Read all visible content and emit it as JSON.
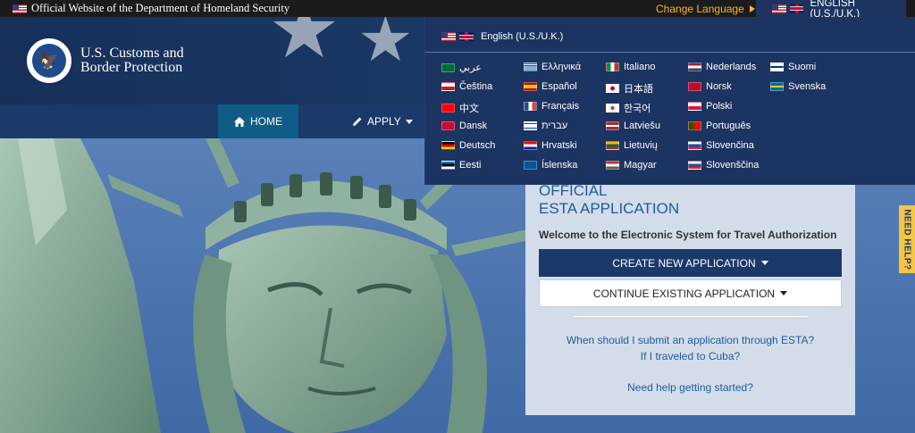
{
  "topbar": {
    "official_text": "Official Website of the Department of Homeland Security",
    "change_language": "Change Language",
    "current_language": "ENGLISH (U.S./U.K.)"
  },
  "header": {
    "title_line1": "U.S. Customs and",
    "title_line2": "Border Protection"
  },
  "nav": {
    "home": "HOME",
    "apply": "APPLY"
  },
  "language_menu": {
    "current": "English (U.S./U.K.)",
    "columns": [
      [
        {
          "label": "عربي",
          "flag": "arabic-flag"
        },
        {
          "label": "Čeština",
          "flag": "czech-flag"
        },
        {
          "label": "中文",
          "flag": "taiwan-flag"
        },
        {
          "label": "Dansk",
          "flag": "danish-flag"
        },
        {
          "label": "Deutsch",
          "flag": "german-flag"
        },
        {
          "label": "Eesti",
          "flag": "estonian-flag"
        }
      ],
      [
        {
          "label": "Ελληνικά",
          "flag": "greek-flag"
        },
        {
          "label": "Español",
          "flag": "spanish-flag"
        },
        {
          "label": "Français",
          "flag": "french-flag"
        },
        {
          "label": "עברית",
          "flag": "israeli-flag"
        },
        {
          "label": "Hrvatski",
          "flag": "croatian-flag"
        },
        {
          "label": "Íslenska",
          "flag": "icelandic-flag"
        }
      ],
      [
        {
          "label": "Italiano",
          "flag": "italian-flag"
        },
        {
          "label": "日本語",
          "flag": "japanese-flag"
        },
        {
          "label": "한국어",
          "flag": "korean-flag"
        },
        {
          "label": "Latviešu",
          "flag": "latvian-flag"
        },
        {
          "label": "Lietuvių",
          "flag": "lithuanian-flag"
        },
        {
          "label": "Magyar",
          "flag": "hungarian-flag"
        }
      ],
      [
        {
          "label": "Nederlands",
          "flag": "dutch-flag"
        },
        {
          "label": "Norsk",
          "flag": "norwegian-flag"
        },
        {
          "label": "Polski",
          "flag": "polish-flag"
        },
        {
          "label": "Português",
          "flag": "portuguese-flag"
        },
        {
          "label": "Slovenčina",
          "flag": "slovak-flag"
        },
        {
          "label": "Slovenščina",
          "flag": "slovenian-flag"
        }
      ],
      [
        {
          "label": "Suomi",
          "flag": "finnish-flag"
        },
        {
          "label": "Svenska",
          "flag": "swedish-flag"
        }
      ]
    ]
  },
  "esta_panel": {
    "heading_line1": "OFFICIAL",
    "heading_line2": "ESTA APPLICATION",
    "welcome": "Welcome to the Electronic System for Travel Authorization",
    "create_button": "CREATE NEW APPLICATION",
    "continue_button": "CONTINUE EXISTING APPLICATION",
    "link_when": "When should I submit an application through ESTA?",
    "link_cuba": "If I traveled to Cuba?",
    "link_help": "Need help getting started?"
  },
  "help_tab": {
    "label": "NEED HELP?"
  },
  "colors": {
    "topbar_bg": "#1b1b1b",
    "nav_bg": "#1b3a6a",
    "accent_gold": "#f5b72e",
    "link_blue": "#1f5c9b",
    "home_active": "#0f5d86"
  }
}
